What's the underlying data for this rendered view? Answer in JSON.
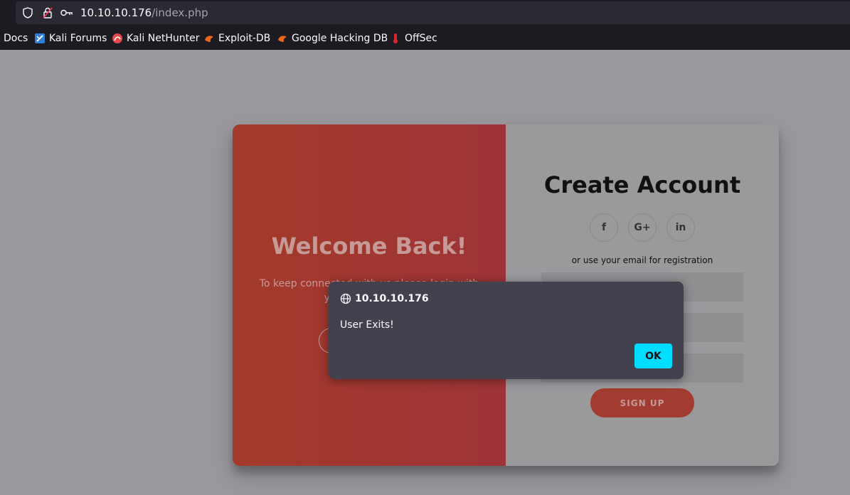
{
  "browser": {
    "url_host": "10.10.10.176",
    "url_path": "/index.php",
    "bookmarks": [
      {
        "label": "Docs",
        "icon": "none"
      },
      {
        "label": "Kali Forums",
        "icon": "kali-forums-icon"
      },
      {
        "label": "Kali NetHunter",
        "icon": "kali-nethunter-icon"
      },
      {
        "label": "Exploit-DB",
        "icon": "exploit-db-icon"
      },
      {
        "label": "Google Hacking DB",
        "icon": "google-hacking-db-icon"
      },
      {
        "label": "OffSec",
        "icon": "offsec-icon"
      }
    ]
  },
  "overlay": {
    "title": "Welcome Back!",
    "text": "To keep connected with us please login with your personal info"
  },
  "form": {
    "title": "Create Account",
    "social": [
      {
        "label": "f",
        "icon": "facebook-icon"
      },
      {
        "label": "G+",
        "icon": "google-plus-icon"
      },
      {
        "label": "in",
        "icon": "linkedin-icon"
      }
    ],
    "subtitle": "or use your email for registration",
    "signup_label": "SIGN UP"
  },
  "dialog": {
    "origin": "10.10.10.176",
    "message": "User Exits!",
    "ok_label": "OK"
  },
  "colors": {
    "overlay_red": "#a33a2a",
    "ok_button": "#00ddff",
    "dialog_bg": "#42414d"
  }
}
